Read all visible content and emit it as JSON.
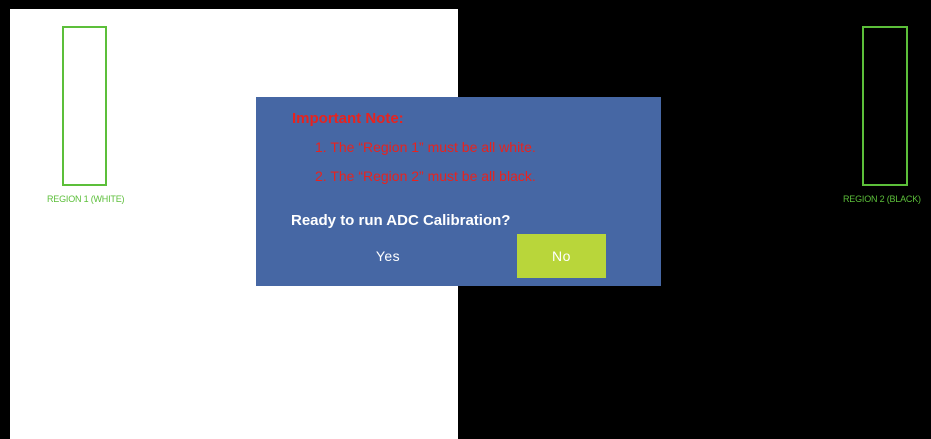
{
  "colors": {
    "background": "#000000",
    "white_region": "#ffffff",
    "black_region": "#000000",
    "region_outline": "#5cbf3a",
    "dialog_bg": "#4667a4",
    "note_text": "#e8231e",
    "dialog_text": "#ffffff",
    "no_button_bg": "#b9d63a"
  },
  "regions": {
    "region1_label": "REGION 1 (WHITE)",
    "region2_label": "REGION 2 (BLACK)"
  },
  "dialog": {
    "note_title": "Important Note:",
    "note_lines": [
      "1. The “Region 1” must be all white.",
      "2. The “Region 2” must be all black."
    ],
    "question": "Ready to run ADC Calibration?",
    "yes_label": "Yes",
    "no_label": "No",
    "selected_button": "No"
  }
}
